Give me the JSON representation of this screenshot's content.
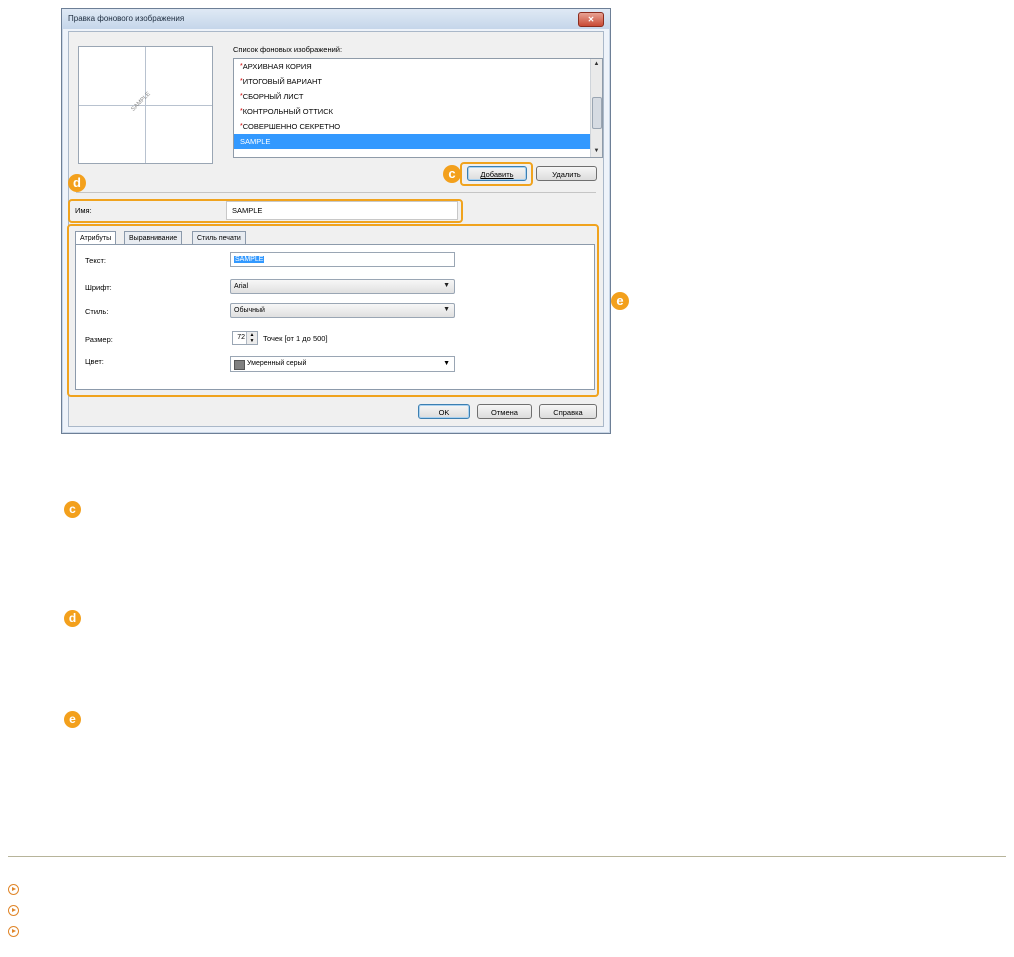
{
  "dialog": {
    "title": "Правка фонового изображения",
    "close_glyph": "✕",
    "preview_watermark": "SAMPLE",
    "list_label": "Список фоновых изображений:",
    "list_items": [
      {
        "label": "АРХИВНАЯ КОРИЯ",
        "builtin": true
      },
      {
        "label": "ИТОГОВЫЙ ВАРИАНТ",
        "builtin": true
      },
      {
        "label": "СБОРНЫЙ ЛИСТ",
        "builtin": true
      },
      {
        "label": "КОНТРОЛЬНЫЙ ОТТИСК",
        "builtin": true
      },
      {
        "label": "СОВЕРШЕННО СЕКРЕТНО",
        "builtin": true
      },
      {
        "label": "SAMPLE",
        "builtin": false,
        "selected": true
      }
    ],
    "add_button": "Добавить",
    "delete_button": "Удалить",
    "name_label": "Имя:",
    "name_value": "SAMPLE",
    "tabs": [
      "Атрибуты",
      "Выравнивание",
      "Стиль печати"
    ],
    "active_tab": "Атрибуты",
    "fields": {
      "text_label": "Текст:",
      "text_value": "SAMPLE",
      "font_label": "Шрифт:",
      "font_value": "Arial",
      "style_label": "Стиль:",
      "style_value": "Обычный",
      "size_label": "Размер:",
      "size_value": "72",
      "size_unit": "Точек [от 1 до 500]",
      "color_label": "Цвет:",
      "color_value": "Умеренный серый",
      "color_swatch": "#808080"
    },
    "ok_button": "OK",
    "cancel_button": "Отмена",
    "help_button": "Справка"
  },
  "callouts": {
    "c": "c",
    "d": "d",
    "e": "e"
  },
  "colors": {
    "callout_orange": "#f3a01c",
    "selection_blue": "#3399ff"
  }
}
